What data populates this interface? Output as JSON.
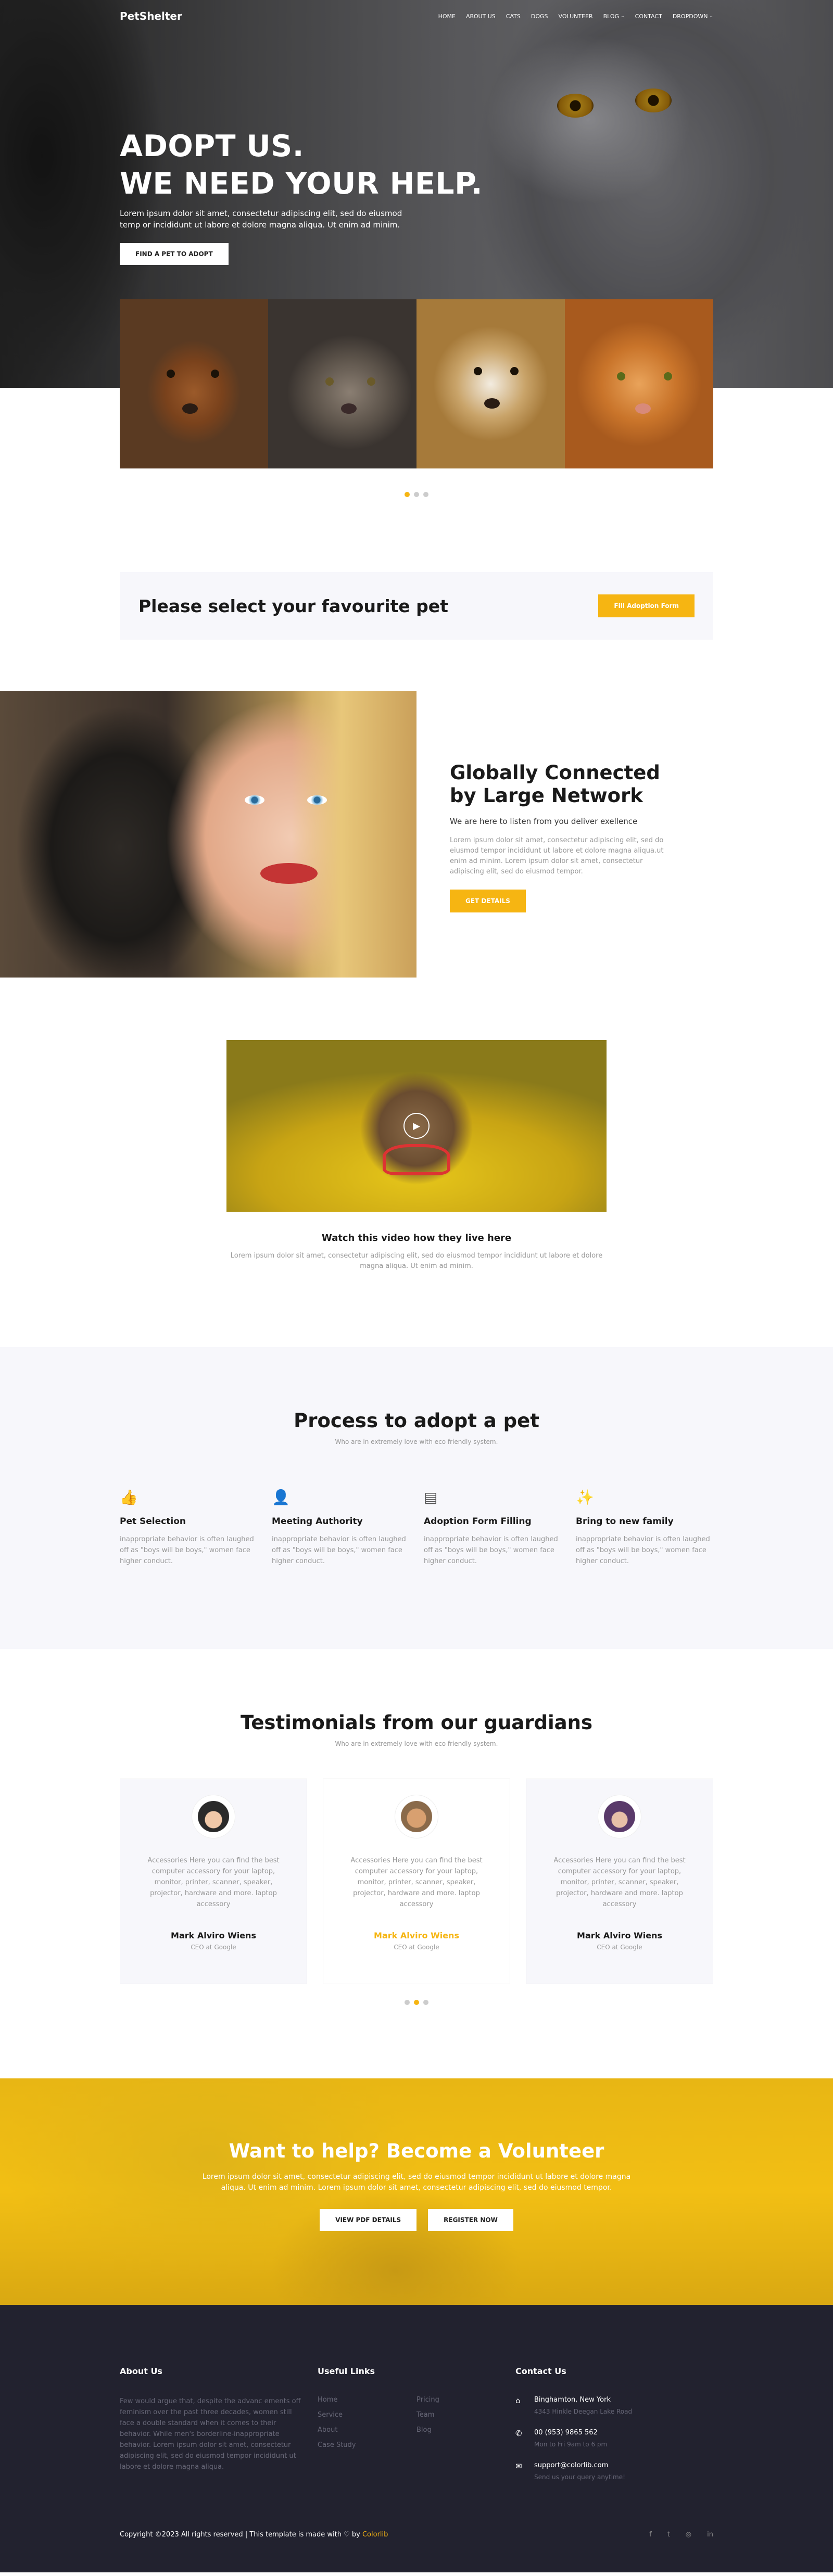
{
  "nav": {
    "logo": "PetShelter",
    "items": [
      {
        "label": "Home",
        "caret": ""
      },
      {
        "label": "About Us",
        "caret": ""
      },
      {
        "label": "Cats",
        "caret": ""
      },
      {
        "label": "Dogs",
        "caret": ""
      },
      {
        "label": "Volunteer",
        "caret": ""
      },
      {
        "label": "Blog",
        "caret": "⌄"
      },
      {
        "label": "Contact",
        "caret": ""
      },
      {
        "label": "Dropdown",
        "caret": "⌄"
      }
    ]
  },
  "hero": {
    "title_line1": "ADOPT US.",
    "title_line2": "WE NEED YOUR HELP.",
    "text": "Lorem ipsum dolor sit amet, consectetur adipiscing elit, sed do eiusmod temp or incididunt ut labore et dolore magna aliqua. Ut enim ad minim.",
    "button": "FIND A PET TO ADOPT"
  },
  "select_pet": {
    "title": "Please select your favourite pet",
    "button": "Fill Adoption Form"
  },
  "network": {
    "title": "Globally Connected by Large Network",
    "subtitle": "We are here to listen from you deliver exellence",
    "text": "Lorem ipsum dolor sit amet, consectetur adipiscing elit, sed do eiusmod tempor incididunt ut labore et dolore magna aliqua.ut enim ad minim. Lorem ipsum dolor sit amet, consectetur adipiscing elit, sed do eiusmod tempor.",
    "button": "GET DETAILS"
  },
  "video": {
    "title": "Watch this video how they live here",
    "text": "Lorem ipsum dolor sit amet, consectetur adipiscing elit, sed do eiusmod tempor incididunt ut labore et dolore magna aliqua. Ut enim ad minim."
  },
  "process": {
    "title": "Process to adopt a pet",
    "subtitle": "Who are in extremely love with eco friendly system.",
    "steps": [
      {
        "icon": "thumbs-up-icon",
        "glyph": "👍",
        "title": "Pet Selection",
        "text": "inappropriate behavior is often laughed off as \"boys will be boys,\" women face higher conduct."
      },
      {
        "icon": "user-icon",
        "glyph": "👤",
        "title": "Meeting Authority",
        "text": "inappropriate behavior is often laughed off as \"boys will be boys,\" women face higher conduct."
      },
      {
        "icon": "form-icon",
        "glyph": "▤",
        "title": "Adoption Form Filling",
        "text": "inappropriate behavior is often laughed off as \"boys will be boys,\" women face higher conduct."
      },
      {
        "icon": "magic-wand-icon",
        "glyph": "✨",
        "title": "Bring to new family",
        "text": "inappropriate behavior is often laughed off as \"boys will be boys,\" women face higher conduct."
      }
    ]
  },
  "testimonials": {
    "title": "Testimonials from our guardians",
    "subtitle": "Who are in extremely love with eco friendly system.",
    "cards": [
      {
        "text": "Accessories Here you can find the best computer accessory for your laptop, monitor, printer, scanner, speaker, projector, hardware and more. laptop accessory",
        "name": "Mark Alviro Wiens",
        "role": "CEO at Google"
      },
      {
        "text": "Accessories Here you can find the best computer accessory for your laptop, monitor, printer, scanner, speaker, projector, hardware and more. laptop accessory",
        "name": "Mark Alviro Wiens",
        "role": "CEO at Google"
      },
      {
        "text": "Accessories Here you can find the best computer accessory for your laptop, monitor, printer, scanner, speaker, projector, hardware and more. laptop accessory",
        "name": "Mark Alviro Wiens",
        "role": "CEO at Google"
      }
    ]
  },
  "volunteer": {
    "title": "Want to help? Become a Volunteer",
    "text": "Lorem ipsum dolor sit amet, consectetur adipiscing elit, sed do eiusmod tempor incididunt ut labore et dolore magna aliqua. Ut enim ad minim. Lorem ipsum dolor sit amet, consectetur adipiscing elit, sed do eiusmod tempor.",
    "button1": "VIEW PDF DETAILS",
    "button2": "REGISTER NOW"
  },
  "footer": {
    "about_title": "About Us",
    "about_text": "Few would argue that, despite the advanc ements off feminism over the past three decades, women still face a double standard when it comes to their behavior. While men's borderline-inappropriate behavior. Lorem ipsum dolor sit amet, consectetur adipiscing elit, sed do eiusmod tempor incididunt ut labore et dolore magna aliqua.",
    "links_title": "Useful Links",
    "links": [
      "Home",
      "Pricing",
      "Service",
      "Team",
      "About",
      "Blog",
      "Case Study"
    ],
    "contact_title": "Contact Us",
    "contact": [
      {
        "icon": "home-icon",
        "glyph": "⌂",
        "line1": "Binghamton, New York",
        "line2": "4343 Hinkle Deegan Lake Road"
      },
      {
        "icon": "phone-icon",
        "glyph": "✆",
        "line1": "00 (953) 9865 562",
        "line2": "Mon to Fri 9am to 6 pm"
      },
      {
        "icon": "mail-icon",
        "glyph": "✉",
        "line1": "support@colorlib.com",
        "line2": "Send us your query anytime!"
      }
    ],
    "copyright": "Copyright ©2023 All rights reserved | This template is made with ♡ by",
    "brand": "Colorlib",
    "social": [
      "f",
      "t",
      "◎",
      "in"
    ]
  },
  "colors": {
    "accent": "#f6b512",
    "footer_bg": "#22222f",
    "light_bg": "#f7f7fb"
  }
}
